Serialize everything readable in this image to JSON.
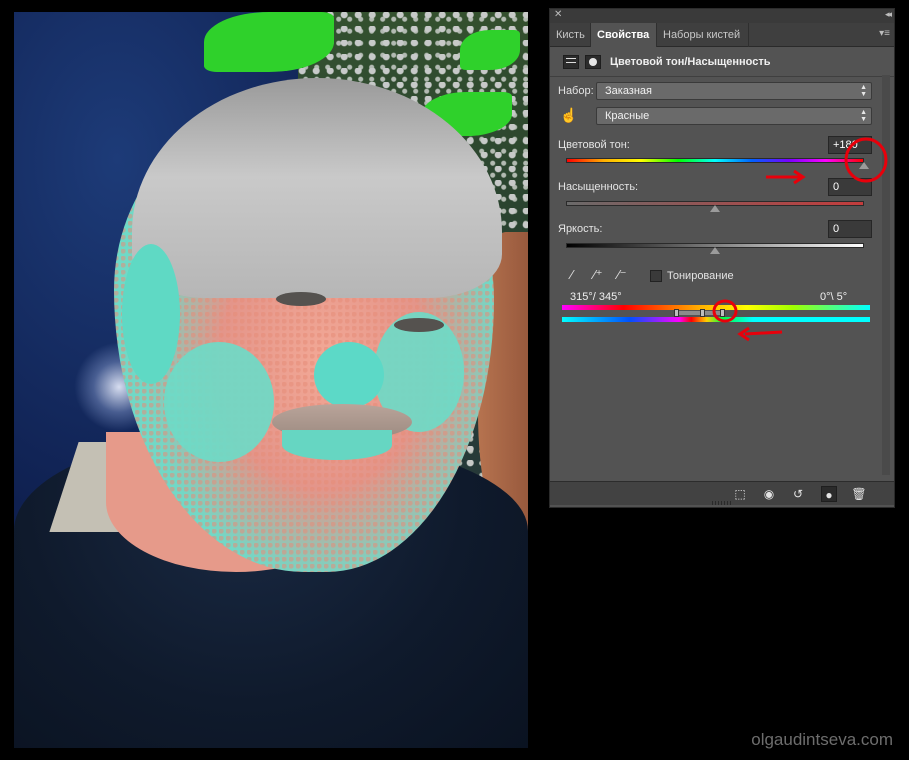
{
  "panel": {
    "tabs": [
      {
        "label": "Кисть"
      },
      {
        "label": "Свойства"
      },
      {
        "label": "Наборы кистей"
      }
    ],
    "title": "Цветовой тон/Насыщенность",
    "preset_label": "Набор:",
    "preset_value": "Заказная",
    "channel_value": "Красные",
    "hue": {
      "label": "Цветовой тон:",
      "value": "+180",
      "position": 1.0
    },
    "saturation": {
      "label": "Насыщенность:",
      "value": "0",
      "position": 0.5
    },
    "lightness": {
      "label": "Яркость:",
      "value": "0",
      "position": 0.5
    },
    "colorize_label": "Тонирование",
    "colorize_checked": false,
    "range_left": "315°/ 345°",
    "range_right": "0°\\ 5°"
  },
  "icons": {
    "close": "close-icon",
    "collapse": "collapse-icon",
    "tab_menu": "panel-menu-icon",
    "adjustment": "adjustment-layer-icon",
    "mask": "mask-icon",
    "on_image": "on-image-hand-icon",
    "eyedroppers": [
      "eyedropper-icon",
      "eyedropper-plus-icon",
      "eyedropper-minus-icon"
    ],
    "bottom": [
      "clip-to-layer-icon",
      "view-previous-state-icon",
      "reset-icon",
      "visibility-icon",
      "delete-icon"
    ]
  },
  "colors": {
    "panel_bg": "#535353",
    "annotation_red": "#e8000b"
  },
  "watermark": "olgaudintseva.com"
}
